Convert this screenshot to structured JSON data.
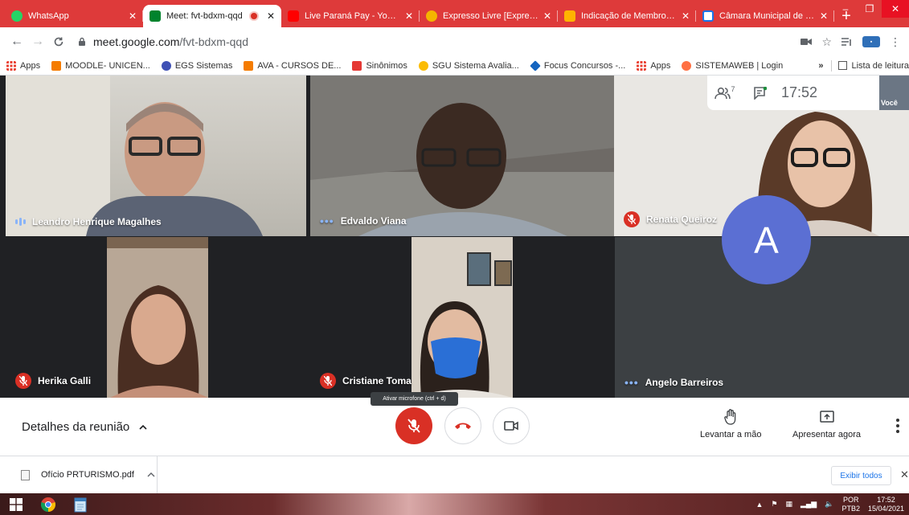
{
  "browser": {
    "tabs": [
      {
        "label": "WhatsApp",
        "fav_color": "#25d366",
        "active": false,
        "recording": false
      },
      {
        "label": "Meet: fvt-bdxm-qqd",
        "fav_color": "#00832d",
        "active": true,
        "recording": true
      },
      {
        "label": "Live Paraná Pay - YouTub",
        "fav_color": "#ff0000",
        "active": false,
        "recording": false
      },
      {
        "label": "Expresso Livre [Expresso",
        "fav_color": "#f4b400",
        "active": false,
        "recording": false
      },
      {
        "label": "Indicação de Membros p",
        "fav_color": "#ffb300",
        "active": false,
        "recording": false
      },
      {
        "label": "Câmara Municipal de Lo",
        "fav_color": "#1a73e8",
        "active": false,
        "recording": false
      }
    ],
    "new_tab": "+",
    "window_controls": {
      "minimize": "–",
      "maximize": "❐",
      "close": "✕"
    },
    "url": {
      "host": "meet.google.com",
      "path": "/fvt-bdxm-qqd"
    },
    "bookmarks": [
      {
        "label": "Apps",
        "color": "#ea4335"
      },
      {
        "label": "MOODLE- UNICEN...",
        "color": "#f57c00"
      },
      {
        "label": "EGS Sistemas",
        "color": "#3f51b5"
      },
      {
        "label": "AVA - CURSOS DE...",
        "color": "#f57c00"
      },
      {
        "label": "Sinônimos",
        "color": "#e53935"
      },
      {
        "label": "SGU Sistema Avalia...",
        "color": "#fbbc04"
      },
      {
        "label": "Focus Concursos -...",
        "color": "#1565c0"
      },
      {
        "label": "Apps",
        "color": "#ea4335"
      },
      {
        "label": "SISTEMAWEB | Login",
        "color": "#ff7043"
      }
    ],
    "bookmarks_more": "»",
    "reading_list": "Lista de leitura"
  },
  "meet": {
    "participant_count": "7",
    "clock": "17:52",
    "self_label": "Você",
    "participants": [
      {
        "name": "Leandro Henrique Magalhes",
        "status": "speaking"
      },
      {
        "name": "Edvaldo Viana",
        "status": "dots"
      },
      {
        "name": "Renata Queiroz",
        "status": "muted"
      },
      {
        "name": "Herika Galli",
        "status": "muted"
      },
      {
        "name": "Cristiane Toma",
        "status": "muted"
      },
      {
        "name": "Angelo Barreiros",
        "status": "dots"
      }
    ],
    "avatar_letter": "A",
    "avatar_color": "#5b6fd3",
    "tooltip": "Ativar microfone (ctrl + d)",
    "details_label": "Detalhes da reunião",
    "raise_hand": "Levantar a mão",
    "present_now": "Apresentar agora"
  },
  "downloads": {
    "file": "Ofício PRTURISMO.pdf",
    "show_all": "Exibir todos",
    "close": "✕"
  },
  "taskbar": {
    "lang_top": "POR",
    "lang_bottom": "PTB2",
    "time": "17:52",
    "date": "15/04/2021"
  },
  "colors": {
    "tab_bar": "#de3a3a",
    "meet_dark": "#202124",
    "mic_red": "#d93025",
    "link_blue": "#1a73e8"
  }
}
